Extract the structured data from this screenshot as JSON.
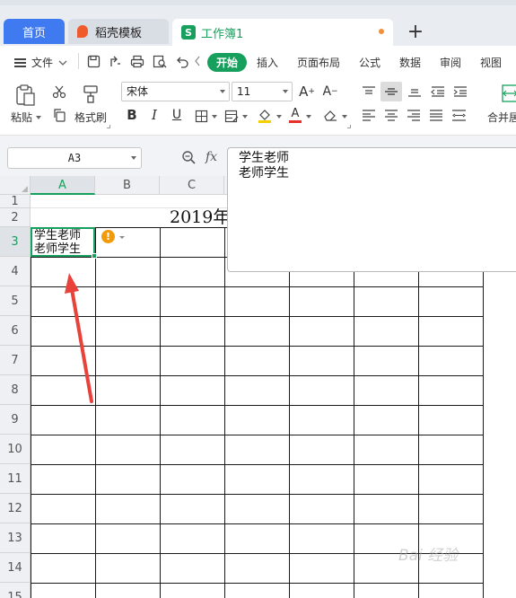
{
  "tabs": [
    {
      "label": "首页"
    },
    {
      "label": "稻壳模板"
    },
    {
      "label": "工作簿1",
      "logo": "S"
    }
  ],
  "menubar": {
    "file_label": "文件",
    "items": [
      "开始",
      "插入",
      "页面布局",
      "公式",
      "数据",
      "审阅",
      "视图"
    ]
  },
  "toolbar": {
    "paste_label": "粘贴",
    "format_painter_label": "格式刷",
    "font_name": "宋体",
    "font_size": "11",
    "merge_label": "合并居"
  },
  "formula_bar": {
    "cell_ref": "A3",
    "fx": "fx",
    "content_line1": "学生老师",
    "content_line2": "老师学生"
  },
  "sheet": {
    "columns": [
      "A",
      "B",
      "C"
    ],
    "rows": [
      "1",
      "2",
      "3",
      "4",
      "5",
      "6",
      "7",
      "8",
      "9",
      "10",
      "11",
      "12",
      "13",
      "14",
      "15"
    ],
    "title_text": "2019年",
    "a3_line1": "学生老师",
    "a3_line2": "老师学生",
    "active_cell": "A3"
  },
  "colors": {
    "accent_green": "#17a05d",
    "home_tab_blue": "#3f7af0",
    "arrow_red": "#e8423a",
    "warning_orange": "#f29b0a"
  },
  "watermark_text": "Bai 经验"
}
